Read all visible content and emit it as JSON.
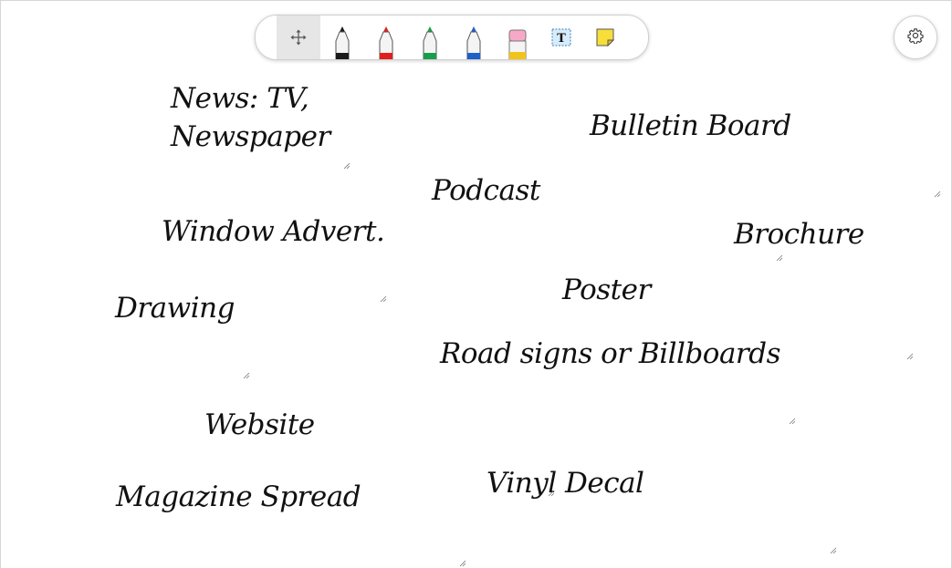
{
  "toolbar": {
    "tools": [
      {
        "name": "move-tool",
        "icon": "move-arrows-icon",
        "selected": true
      },
      {
        "name": "black-marker",
        "icon": "marker-icon",
        "color": "#1a1a1a"
      },
      {
        "name": "red-marker",
        "icon": "marker-icon",
        "color": "#e01e1e"
      },
      {
        "name": "green-marker",
        "icon": "marker-icon",
        "color": "#1a9e4b"
      },
      {
        "name": "blue-marker",
        "icon": "marker-icon",
        "color": "#1f5fc8"
      },
      {
        "name": "highlighter",
        "icon": "highlighter-icon",
        "color": "#f2c318"
      },
      {
        "name": "text-tool",
        "icon": "text-box-icon",
        "glyph": "T"
      },
      {
        "name": "sticky-note-tool",
        "icon": "sticky-note-icon",
        "color": "#f7de3a"
      }
    ]
  },
  "settings": {
    "icon": "gear-icon"
  },
  "notes": [
    {
      "text": "News: TV, Newspaper"
    },
    {
      "text": "Bulletin Board"
    },
    {
      "text": "Podcast"
    },
    {
      "text": "Window Advert."
    },
    {
      "text": "Brochure"
    },
    {
      "text": "Drawing"
    },
    {
      "text": "Poster"
    },
    {
      "text": "Road signs or Billboards"
    },
    {
      "text": "Website"
    },
    {
      "text": "Magazine Spread"
    },
    {
      "text": "Vinyl Decal"
    }
  ]
}
